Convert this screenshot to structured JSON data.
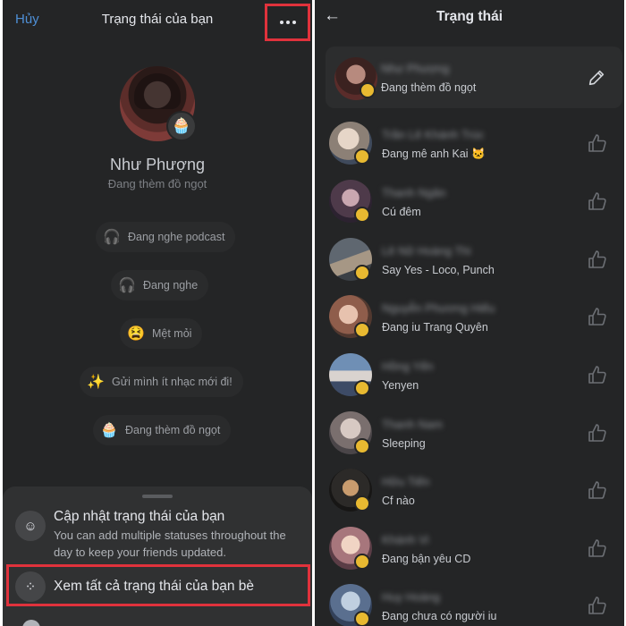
{
  "left": {
    "cancel_label": "Hủy",
    "title": "Trạng thái của bạn",
    "more_label": "•••",
    "profile_name": "Như Phượng",
    "profile_status": "Đang thèm đồ ngọt",
    "pills": [
      {
        "icon": "🎧",
        "label": "Đang nghe podcast"
      },
      {
        "icon": "🎧",
        "label": "Đang nghe"
      },
      {
        "icon": "😫",
        "label": "Mệt mỏi"
      },
      {
        "icon": "✨",
        "label": "Gửi mình ít nhạc mới đi!"
      },
      {
        "icon": "🧁",
        "label": "Đang thèm đồ ngọt"
      }
    ],
    "sheet": {
      "update_title": "Cập nhật trạng thái của bạn",
      "update_sub": "You can add multiple statuses throughout the day to keep your friends updated.",
      "view_all": "Xem tất cả trạng thái của bạn bè"
    }
  },
  "right": {
    "title": "Trạng thái",
    "back_icon": "arrow-left-icon",
    "my_status": {
      "name": "Như Phượng",
      "status": "Đang thèm đồ ngọt"
    },
    "friends": [
      {
        "name": "Trần Lê Khánh Trúc",
        "status": "Đang mê anh Kai 🐱"
      },
      {
        "name": "Thanh Ngân",
        "status": "Cú đêm"
      },
      {
        "name": "Lê Nữ Hoàng Thi",
        "status": "Say Yes - Loco, Punch"
      },
      {
        "name": "Nguyễn Phương Hiếu",
        "status": "Đang iu Trang Quyên"
      },
      {
        "name": "Hồng Yến",
        "status": "Yenyen"
      },
      {
        "name": "Thanh Nam",
        "status": "Sleeping"
      },
      {
        "name": "Hữu Tiến",
        "status": "Cf nào"
      },
      {
        "name": "Khánh Vi",
        "status": "Đang bận yêu CD"
      },
      {
        "name": "Huy Hoàng",
        "status": "Đang chưa có người iu"
      }
    ]
  },
  "colors": {
    "background": "#242526",
    "accent": "#4e8fd6",
    "highlight": "#e0323c"
  }
}
